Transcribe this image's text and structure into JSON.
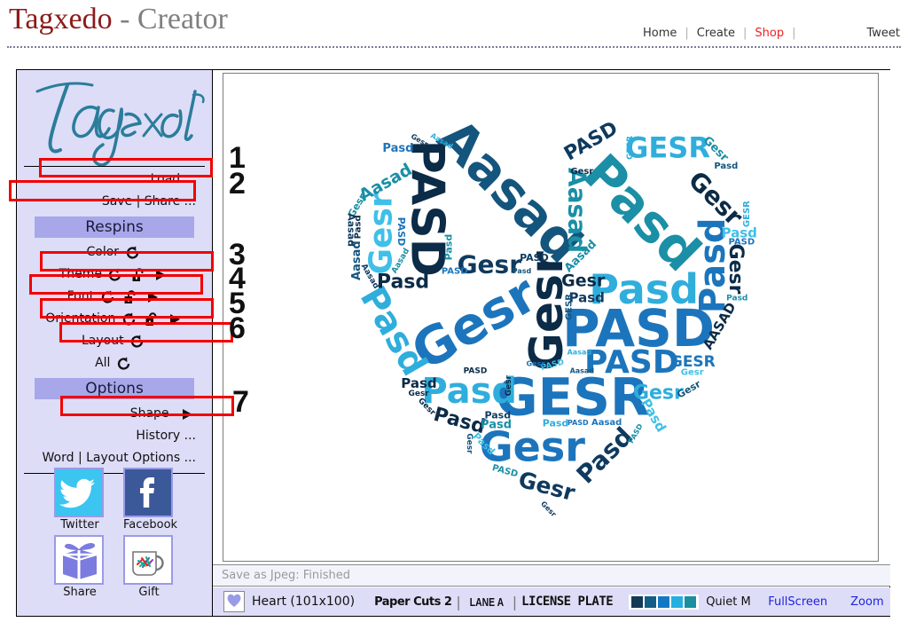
{
  "header": {
    "brand_main": "Tagxedo",
    "brand_sub": " - Creator",
    "nav": [
      {
        "label": "Home",
        "name": "nav-home",
        "style": "normal"
      },
      {
        "label": "Create",
        "name": "nav-create",
        "style": "normal"
      },
      {
        "label": "Shop",
        "name": "nav-shop",
        "style": "red"
      }
    ],
    "tweet": "Tweet"
  },
  "sidebar": {
    "logo_text": "Tagxedo",
    "items": [
      {
        "label": "Load ...",
        "name": "load-item",
        "align": "right",
        "icons": []
      },
      {
        "label": "Save | Share ...",
        "name": "save-share-item",
        "align": "right",
        "icons": []
      },
      {
        "label": "Respins",
        "name": "respins-header",
        "align": "bar",
        "icons": []
      },
      {
        "label": "Color",
        "name": "color-item",
        "align": "center",
        "icons": [
          "refresh-icon"
        ]
      },
      {
        "label": "Theme",
        "name": "theme-item",
        "align": "center",
        "icons": [
          "refresh-icon",
          "unlock-icon",
          "play-icon"
        ]
      },
      {
        "label": "Font",
        "name": "font-item",
        "align": "center",
        "icons": [
          "refresh-icon",
          "unlock-icon",
          "play-icon"
        ]
      },
      {
        "label": "Orientation",
        "name": "orientation-item",
        "align": "center",
        "icons": [
          "refresh-icon",
          "unlock-icon",
          "play-icon"
        ]
      },
      {
        "label": "Layout",
        "name": "layout-item",
        "align": "center",
        "icons": [
          "refresh-icon"
        ]
      },
      {
        "label": "All",
        "name": "all-item",
        "align": "center",
        "icons": [
          "refresh-icon"
        ]
      },
      {
        "label": "Options",
        "name": "options-header",
        "align": "bar",
        "icons": []
      },
      {
        "label": "Shape",
        "name": "shape-item",
        "align": "right",
        "icons": [
          "play-icon"
        ]
      },
      {
        "label": "History ...",
        "name": "history-item",
        "align": "right",
        "icons": []
      },
      {
        "label": "Word | Layout Options ...",
        "name": "word-layout-options-item",
        "align": "right",
        "icons": []
      }
    ],
    "social": [
      {
        "label": "Twitter",
        "name": "twitter-button",
        "icon": "twitter-bird-icon",
        "color": "#3BC5F0"
      },
      {
        "label": "Facebook",
        "name": "facebook-button",
        "icon": "facebook-f-icon",
        "color": "#3B5998"
      },
      {
        "label": "Share",
        "name": "share-button",
        "icon": "gift-box-icon",
        "color": "#ffffff"
      },
      {
        "label": "Gift",
        "name": "gift-button",
        "icon": "mug-icon",
        "color": "#ffffff"
      }
    ]
  },
  "status": {
    "message": "Save as Jpeg: Finished",
    "shape_icon": "heart-icon",
    "shape_name": "Heart (101x100)",
    "fonts": [
      "Paper Cuts 2",
      "LANE A",
      "LICENSE PLATE"
    ],
    "font_separator": "|",
    "theme_swatches": [
      "#123A56",
      "#125E86",
      "#1378C4",
      "#26AEE0",
      "#1A8FA0"
    ],
    "theme_name": "Quiet M",
    "fullscreen": "FullScreen",
    "zoom": "Zoom"
  },
  "annotations": {
    "numbers": [
      "1",
      "2",
      "3",
      "4",
      "5",
      "6",
      "7"
    ]
  },
  "cloud": {
    "shape": "heart",
    "words": [
      "PASD",
      "GESR",
      "AASAD",
      "Gesr",
      "Pasd",
      "Aasad"
    ],
    "palette": [
      "#0F3A5F",
      "#14557E",
      "#1C75BC",
      "#2FAEDC",
      "#1A8FA6",
      "#3EC0E8",
      "#0B2B47"
    ]
  },
  "colors": {
    "sidebar_bg": "#DDDDF8",
    "bar_bg": "#A7A7EA",
    "annotation": "#f20000",
    "link": "#2222dd",
    "shop": "#ee2222",
    "logo_teal": "#2A7D9B"
  }
}
